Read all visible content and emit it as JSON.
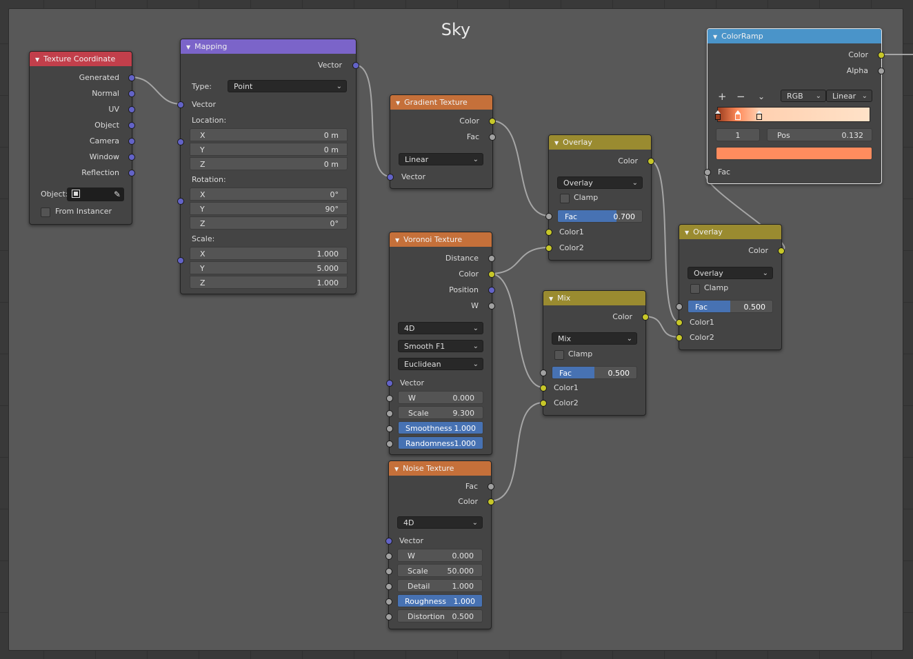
{
  "frame_title": "Sky",
  "texture_coordinate": {
    "title": "Texture Coordinate",
    "outputs": [
      "Generated",
      "Normal",
      "UV",
      "Object",
      "Camera",
      "Window",
      "Reflection"
    ],
    "object_label": "Object:",
    "from_instancer": "From Instancer"
  },
  "mapping": {
    "title": "Mapping",
    "output": "Vector",
    "type_label": "Type:",
    "type_value": "Point",
    "vector_label": "Vector",
    "location_label": "Location:",
    "location": [
      {
        "axis": "X",
        "value": "0 m"
      },
      {
        "axis": "Y",
        "value": "0 m"
      },
      {
        "axis": "Z",
        "value": "0 m"
      }
    ],
    "rotation_label": "Rotation:",
    "rotation": [
      {
        "axis": "X",
        "value": "0°"
      },
      {
        "axis": "Y",
        "value": "90°"
      },
      {
        "axis": "Z",
        "value": "0°"
      }
    ],
    "scale_label": "Scale:",
    "scale": [
      {
        "axis": "X",
        "value": "1.000"
      },
      {
        "axis": "Y",
        "value": "5.000"
      },
      {
        "axis": "Z",
        "value": "1.000"
      }
    ]
  },
  "gradient_texture": {
    "title": "Gradient Texture",
    "outputs": [
      "Color",
      "Fac"
    ],
    "type_value": "Linear",
    "input": "Vector"
  },
  "voronoi_texture": {
    "title": "Voronoi Texture",
    "outputs": [
      "Distance",
      "Color",
      "Position",
      "W"
    ],
    "dimensions": "4D",
    "feature": "Smooth F1",
    "metric": "Euclidean",
    "vector_label": "Vector",
    "inputs": [
      {
        "label": "W",
        "value": "0.000"
      },
      {
        "label": "Scale",
        "value": "9.300"
      },
      {
        "label": "Smoothness",
        "value": "1.000"
      },
      {
        "label": "Randomness",
        "value": "1.000"
      }
    ]
  },
  "noise_texture": {
    "title": "Noise Texture",
    "outputs": [
      "Fac",
      "Color"
    ],
    "dimensions": "4D",
    "vector_label": "Vector",
    "inputs": [
      {
        "label": "W",
        "value": "0.000"
      },
      {
        "label": "Scale",
        "value": "50.000"
      },
      {
        "label": "Detail",
        "value": "1.000"
      },
      {
        "label": "Roughness",
        "value": "1.000"
      },
      {
        "label": "Distortion",
        "value": "0.500"
      }
    ]
  },
  "overlay1": {
    "title": "Overlay",
    "output": "Color",
    "blend_mode": "Overlay",
    "clamp": "Clamp",
    "fac_label": "Fac",
    "fac_value": "0.700",
    "fac_fraction": 0.7,
    "input1": "Color1",
    "input2": "Color2"
  },
  "mix": {
    "title": "Mix",
    "output": "Color",
    "blend_mode": "Mix",
    "clamp": "Clamp",
    "fac_label": "Fac",
    "fac_value": "0.500",
    "fac_fraction": 0.5,
    "input1": "Color1",
    "input2": "Color2"
  },
  "overlay2": {
    "title": "Overlay",
    "output": "Color",
    "blend_mode": "Overlay",
    "clamp": "Clamp",
    "fac_label": "Fac",
    "fac_value": "0.500",
    "fac_fraction": 0.5,
    "input1": "Color1",
    "input2": "Color2"
  },
  "colorramp": {
    "title": "ColorRamp",
    "outputs": [
      "Color",
      "Alpha"
    ],
    "add_icon": "+",
    "remove_icon": "−",
    "color_mode": "RGB",
    "interpolation": "Linear",
    "stop_index": "1",
    "pos_label": "Pos",
    "pos_value": "0.132",
    "input": "Fac",
    "ramp_colors": [
      "#9a3d1e",
      "#ff8a5a",
      "#ffd0b0",
      "#ffe2c8"
    ],
    "active_color": "#ff8c5e"
  },
  "colors": {
    "socket_vector": "#6363c7",
    "socket_color": "#c7c729",
    "socket_float": "#a1a1a1",
    "slider_fill": "#4772b3"
  }
}
